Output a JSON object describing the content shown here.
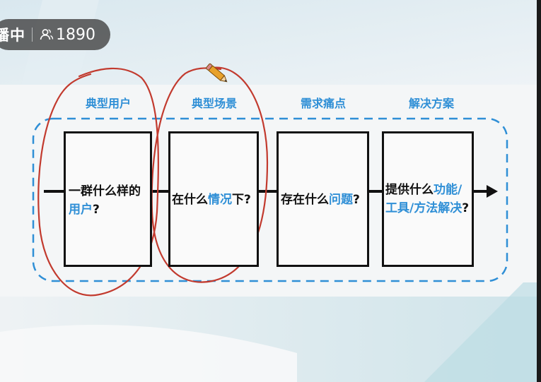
{
  "live": {
    "status_text": "播中",
    "viewer_count": "1890"
  },
  "diagram": {
    "stages": [
      {
        "label": "典型用户"
      },
      {
        "label": "典型场景"
      },
      {
        "label": "需求痛点"
      },
      {
        "label": "解决方案"
      }
    ],
    "boxes": {
      "users": {
        "line1": "一群什么样的",
        "line2_hl": "用户",
        "line2_tail": "?"
      },
      "scene": {
        "pre": "在什么",
        "hl": "情况",
        "post": "下?"
      },
      "problem": {
        "pre": "存在什么",
        "hl": "问题",
        "post": "?"
      },
      "solution": {
        "line1_pre": "提供什么",
        "line1_hl": "功能/",
        "line2_hl": "工具/方法解决",
        "line2_post": "?"
      }
    }
  },
  "colors": {
    "accent_blue": "#2f8fd6",
    "annotation_red": "#c23a2e"
  },
  "annotation_tool_icon": "pencil-icon"
}
